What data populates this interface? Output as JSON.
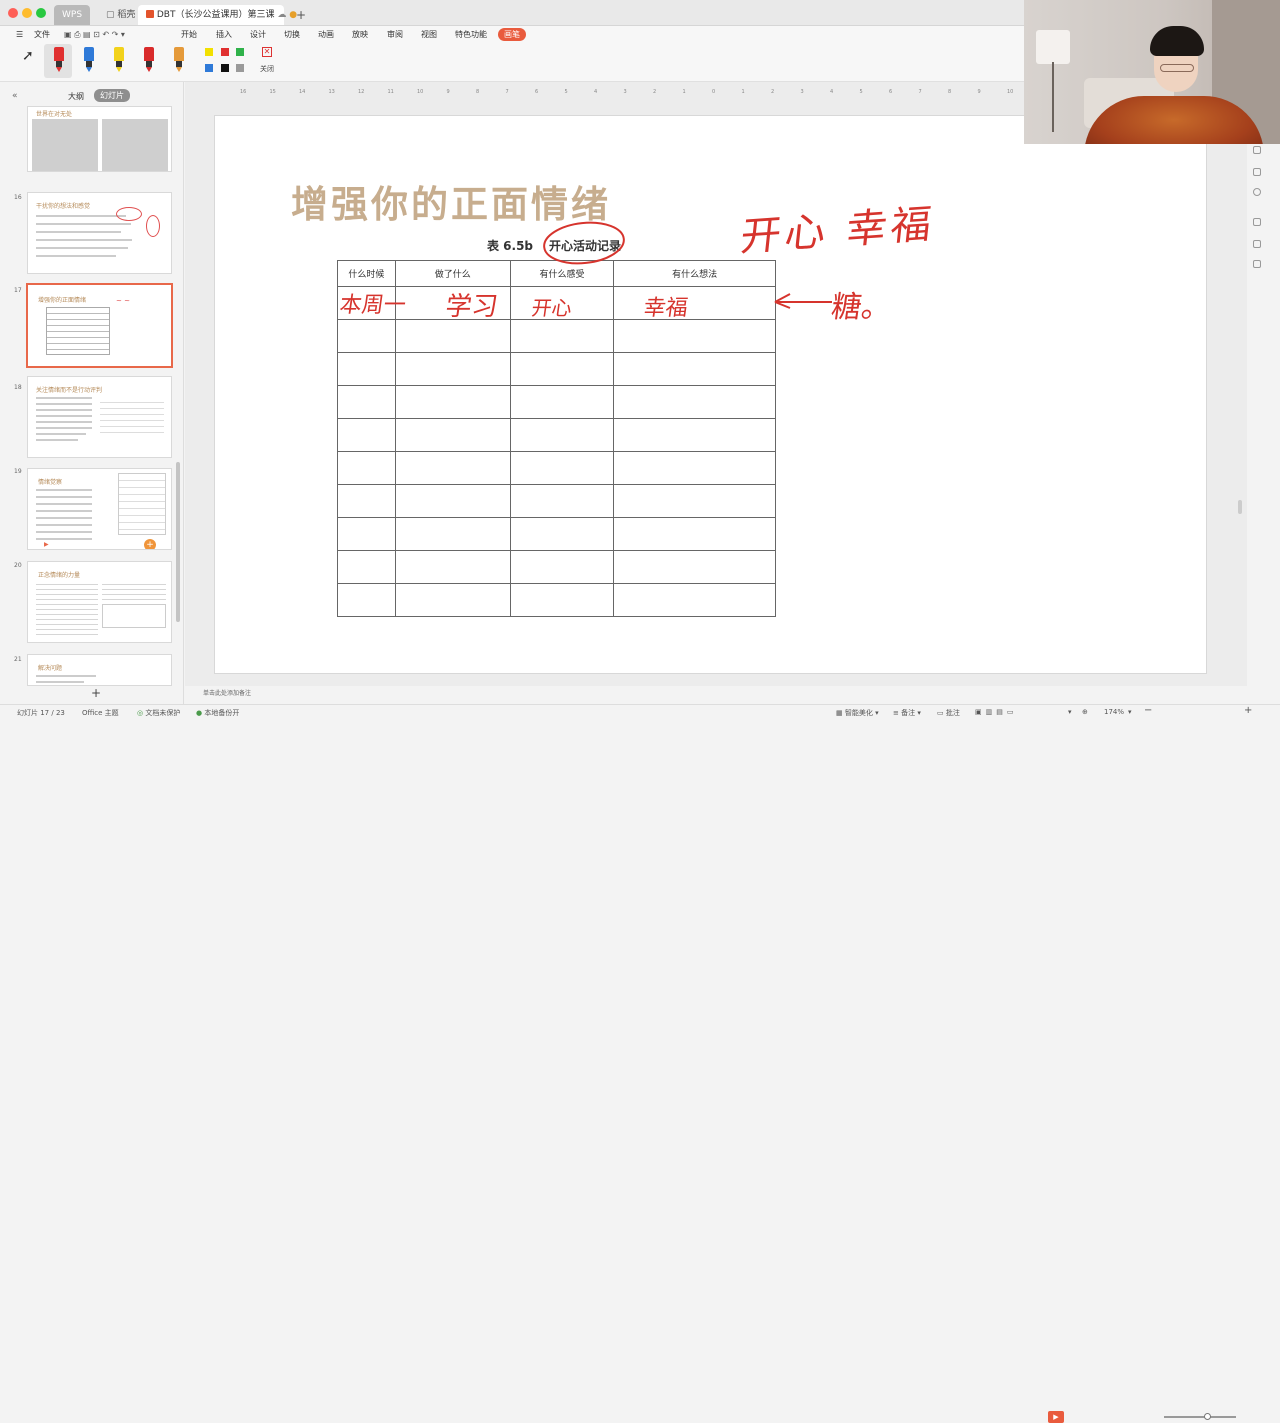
{
  "titlebar": {
    "tabs": [
      {
        "label": "WPS"
      },
      {
        "label": "稻壳"
      },
      {
        "label": "DBT（长沙公益课用）第三课"
      }
    ],
    "new_tab": "+"
  },
  "menubar": {
    "file": "文件",
    "items": [
      "开始",
      "插入",
      "设计",
      "切换",
      "动画",
      "放映",
      "审阅",
      "视图",
      "特色功能",
      "画笔"
    ]
  },
  "toolbar": {
    "close_label": "关闭",
    "pen_colors": [
      "#e03030",
      "#2f7ad8",
      "#f2d21b",
      "#d92b2b",
      "#e59a3a"
    ],
    "swatches": [
      "#f2e000",
      "#e03030",
      "#2fb24a",
      "#2f7ad8",
      "#111111",
      "#9a9a9a"
    ]
  },
  "leftpane": {
    "tab_outline": "大纲",
    "tab_slides": "幻灯片",
    "thumbs": [
      {
        "num": "",
        "title": "世界在对无处"
      },
      {
        "num": "16",
        "title": "干扰你的想法和感觉"
      },
      {
        "num": "17",
        "title": "增强你的正面情绪"
      },
      {
        "num": "18",
        "title": "关注情绪而不是行动评判"
      },
      {
        "num": "19",
        "title": "情绪觉察"
      },
      {
        "num": "20",
        "title": "正念情绪的力量"
      },
      {
        "num": "21",
        "title": "解决问题"
      }
    ],
    "add": "+"
  },
  "slide": {
    "title": "增强你的正面情绪",
    "table_caption_prefix": "表 6.5b",
    "table_caption": "开心活动记录",
    "headers": [
      "什么时候",
      "做了什么",
      "有什么感受",
      "有什么想法"
    ],
    "row_count": 10,
    "ink": {
      "r1c1": "本周一",
      "r1c2": "学习",
      "r1c3": "开心",
      "r1c4": "幸福",
      "side_top": "开心 幸福",
      "side_right": "糖。"
    },
    "notes_hint": "单击此处添加备注"
  },
  "ruler": [
    "16",
    "15",
    "14",
    "13",
    "12",
    "11",
    "10",
    "9",
    "8",
    "7",
    "6",
    "5",
    "4",
    "3",
    "2",
    "1",
    "0",
    "1",
    "2",
    "3",
    "4",
    "5",
    "6",
    "7",
    "8",
    "9",
    "10"
  ],
  "statusbar": {
    "slide_count": "幻灯片 17 / 23",
    "theme": "Office 主题",
    "doc_protect": "文档未保护",
    "backup": "本地备份开",
    "beautify": "智能美化",
    "notes": "备注",
    "comments": "批注",
    "zoom": "174%"
  }
}
